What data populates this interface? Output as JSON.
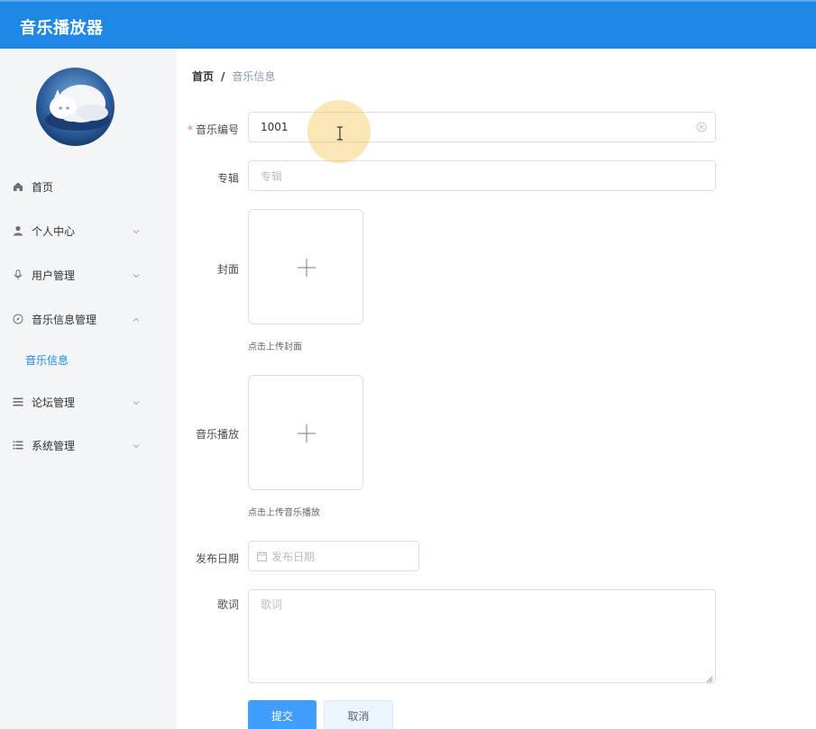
{
  "app": {
    "title": "音乐播放器"
  },
  "sidebar": {
    "avatar_icon": "cat-avatar-image",
    "items": [
      {
        "label": "首页",
        "icon": "home-icon"
      },
      {
        "label": "个人中心",
        "icon": "user-icon"
      },
      {
        "label": "用户管理",
        "icon": "microphone-icon"
      },
      {
        "label": "音乐信息管理",
        "icon": "compass-icon",
        "expanded": true
      },
      {
        "label": "论坛管理",
        "icon": "list-icon"
      },
      {
        "label": "系统管理",
        "icon": "list-icon"
      }
    ],
    "sub_active": "音乐信息"
  },
  "breadcrumb": {
    "home": "首页",
    "separator": "/",
    "current": "音乐信息"
  },
  "form": {
    "music_no": {
      "label": "音乐编号",
      "required_mark": "*",
      "value": "1001"
    },
    "album": {
      "label": "专辑",
      "placeholder": "专辑"
    },
    "cover": {
      "label": "封面",
      "hint": "点击上传封面"
    },
    "play": {
      "label": "音乐播放",
      "hint": "点击上传音乐播放"
    },
    "date": {
      "label": "发布日期",
      "placeholder": "发布日期"
    },
    "lyrics": {
      "label": "歌词",
      "placeholder": "歌词"
    },
    "submit_label": "提交",
    "cancel_label": "取消"
  },
  "colors": {
    "header": "#1e88e5",
    "primary": "#409eff",
    "active_text": "#1e88e5",
    "required": "#f56c6c"
  }
}
